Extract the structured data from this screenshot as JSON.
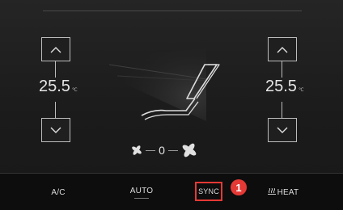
{
  "climate": {
    "left_zone": {
      "temperature": "25.5",
      "unit": "℃"
    },
    "right_zone": {
      "temperature": "25.5",
      "unit": "℃"
    },
    "fan_speed": "0"
  },
  "bottom_bar": {
    "ac_label": "A/C",
    "auto_label": "AUTO",
    "sync_label": "SYNC",
    "heat_label": "HEAT",
    "heat_icon": "seat-heat-icon"
  },
  "annotation": {
    "badge_number": "1",
    "highlight_color": "#e53935"
  },
  "colors": {
    "background": "#1d1d1d",
    "accent_red": "#e53935",
    "text": "#e6e6e6"
  }
}
